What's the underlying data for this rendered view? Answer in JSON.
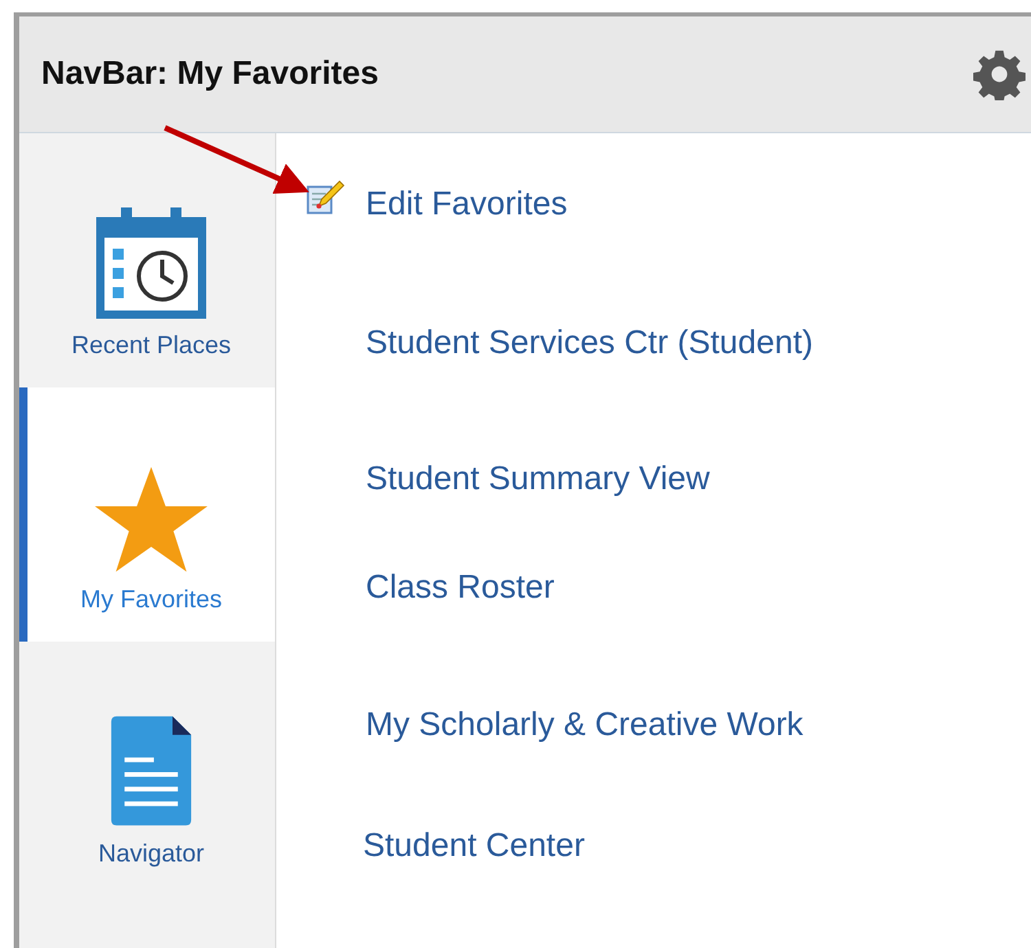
{
  "header": {
    "title": "NavBar: My Favorites"
  },
  "tabs": [
    {
      "label": "Recent Places",
      "kind": "calendar",
      "selected": false
    },
    {
      "label": "My Favorites",
      "kind": "star",
      "selected": true
    },
    {
      "label": "Navigator",
      "kind": "document",
      "selected": false
    }
  ],
  "favorites": [
    {
      "label": "Edit Favorites",
      "kind": "edit"
    },
    {
      "label": "Student Services Ctr (Student)",
      "kind": "link"
    },
    {
      "label": "Student Summary View",
      "kind": "link"
    },
    {
      "label": "Class Roster",
      "kind": "link"
    },
    {
      "label": "My Scholarly & Creative Work",
      "kind": "link"
    },
    {
      "label": "Student Center",
      "kind": "link"
    }
  ]
}
